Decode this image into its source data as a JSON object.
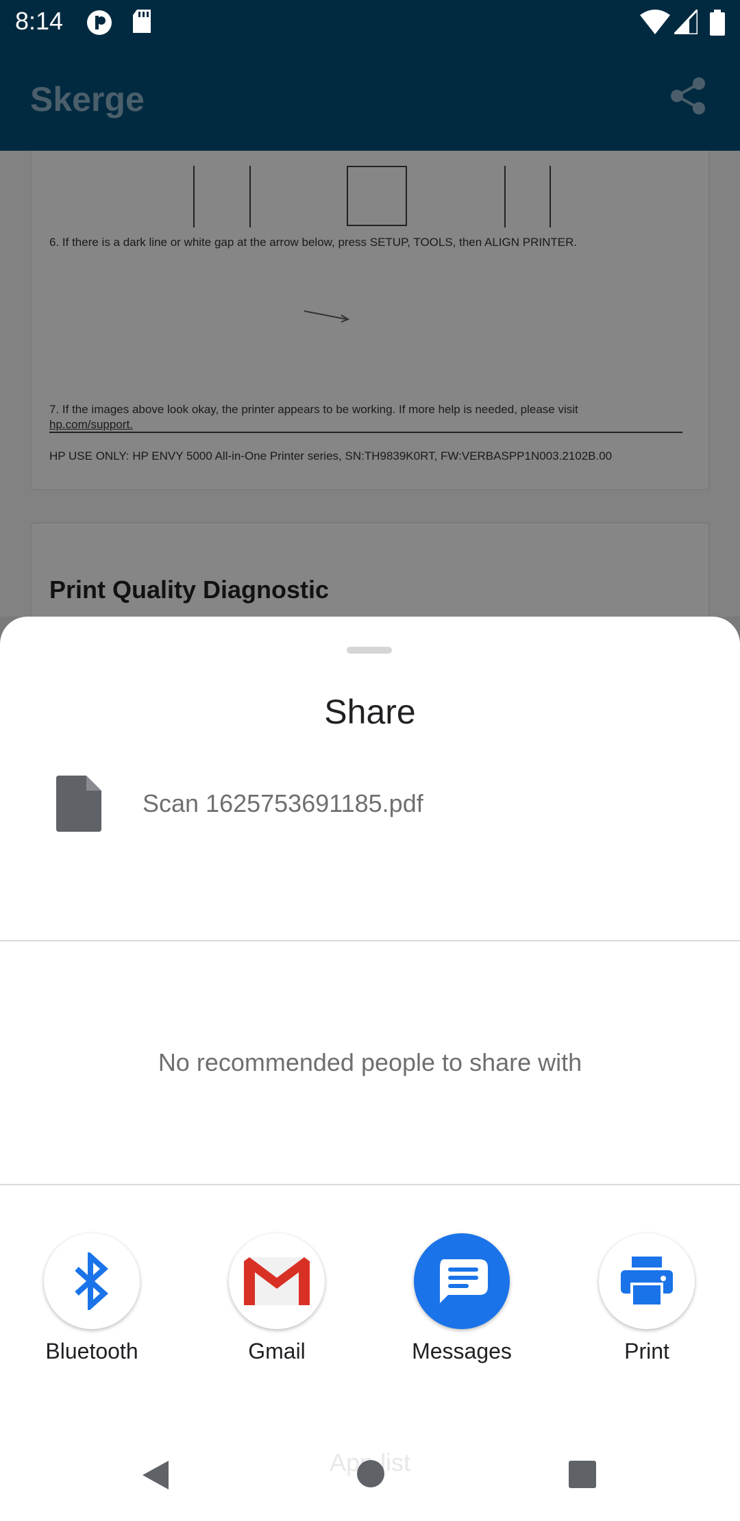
{
  "status_bar": {
    "time": "8:14",
    "icons": [
      "app-notification-icon",
      "sd-card-icon",
      "wifi-icon",
      "signal-icon",
      "battery-icon"
    ]
  },
  "app_bar": {
    "title": "Skerge",
    "action_icon": "share-icon"
  },
  "document": {
    "page1_lines": [
      "6. If there is a dark line or white gap at the arrow below, press SETUP, TOOLS, then ALIGN PRINTER.",
      "7. If the images above look okay, the printer appears to be working. If more help is needed, please visit",
      "hp.com/support.",
      "HP USE ONLY: HP ENVY 5000 All-in-One Printer series, SN:TH9839K0RT, FW:VERBASPP1N003.2102B.00"
    ],
    "page2_title": "Print Quality Diagnostic"
  },
  "share_sheet": {
    "title": "Share",
    "file_icon": "file-icon",
    "file_name": "Scan 1625753691185.pdf",
    "no_people_text": "No recommended people to share with",
    "targets": [
      {
        "label": "Bluetooth",
        "icon": "bluetooth-icon"
      },
      {
        "label": "Gmail",
        "icon": "gmail-icon"
      },
      {
        "label": "Messages",
        "icon": "messages-icon"
      },
      {
        "label": "Print",
        "icon": "print-icon"
      }
    ],
    "colors": {
      "accent_blue": "#1a73e8",
      "gmail_red": "#d93025"
    }
  },
  "nav_bar": {
    "faint_text": "App list",
    "buttons": [
      "back-icon",
      "home-icon",
      "recents-icon"
    ]
  }
}
